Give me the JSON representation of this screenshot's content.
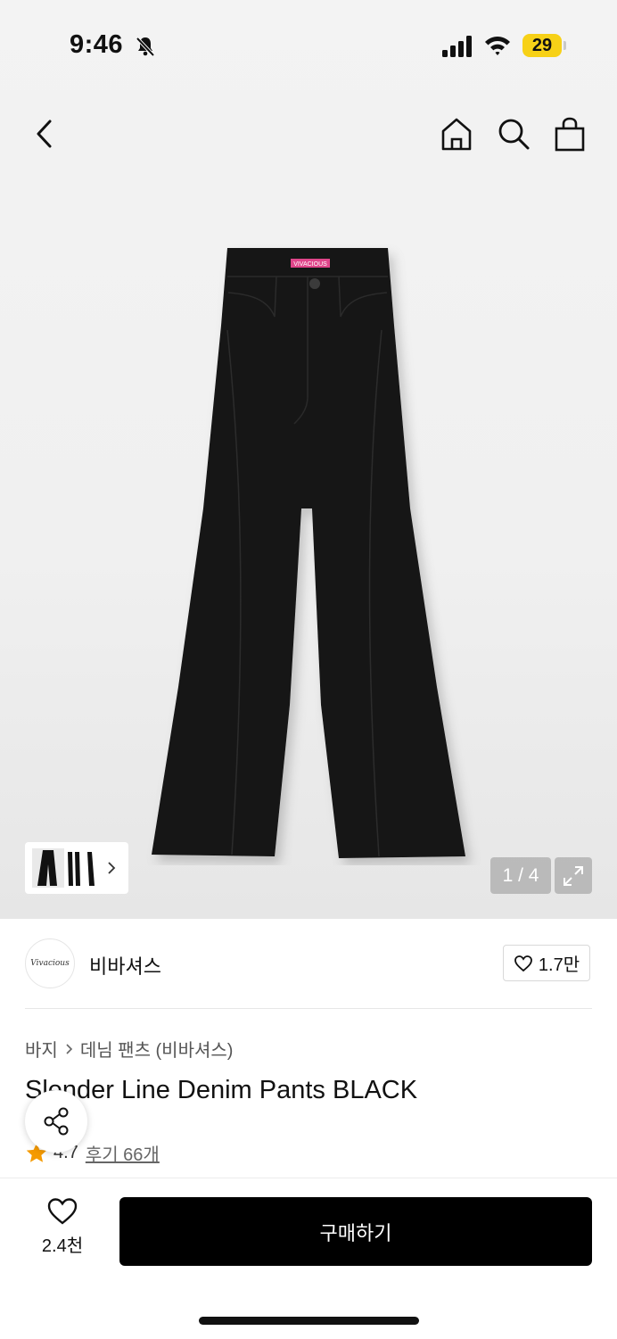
{
  "status_bar": {
    "time": "9:46",
    "battery": "29",
    "battery_color": "#f7d117"
  },
  "nav": {
    "icons": [
      "back-icon",
      "home-icon",
      "search-icon",
      "shopping-bag-icon"
    ]
  },
  "gallery": {
    "counter": "1 / 4",
    "waistband_label": "VIVACIOUS"
  },
  "brand": {
    "logo_text": "Vivacious",
    "name": "비바셔스",
    "likes": "1.7만"
  },
  "breadcrumb": {
    "level1": "바지",
    "level2": "데님 팬츠 (비바셔스)"
  },
  "product": {
    "title": "Slender Line Denim Pants BLACK",
    "rating": "4.7",
    "reviews": "후기 66개"
  },
  "bottom": {
    "wish_count": "2.4천",
    "buy_label": "구매하기"
  }
}
